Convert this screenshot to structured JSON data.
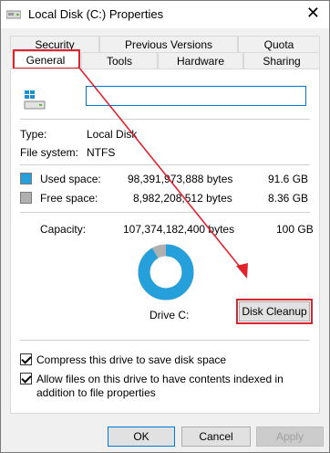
{
  "window": {
    "title": "Local Disk (C:) Properties",
    "close": "✕"
  },
  "tabs": {
    "row1": [
      {
        "label": "Security"
      },
      {
        "label": "Previous Versions"
      },
      {
        "label": "Quota"
      }
    ],
    "row2": [
      {
        "label": "General"
      },
      {
        "label": "Tools"
      },
      {
        "label": "Hardware"
      },
      {
        "label": "Sharing"
      }
    ]
  },
  "general": {
    "name_value": "",
    "type_label": "Type:",
    "type_value": "Local Disk",
    "fs_label": "File system:",
    "fs_value": "NTFS",
    "used_label": "Used space:",
    "used_bytes": "98,391,973,888 bytes",
    "used_gb": "91.6 GB",
    "free_label": "Free space:",
    "free_bytes": "8,982,208,512 bytes",
    "free_gb": "8.36 GB",
    "capacity_label": "Capacity:",
    "capacity_bytes": "107,374,182,400 bytes",
    "capacity_gb": "100 GB",
    "drive_label": "Drive C:",
    "cleanup_button": "Disk Cleanup",
    "compress_label": "Compress this drive to save disk space",
    "index_label": "Allow files on this drive to have contents indexed in addition to file properties",
    "compress_checked": true,
    "index_checked": true,
    "used_fraction": 0.916,
    "colors": {
      "used": "#26a0da",
      "free": "#b0b0b0"
    }
  },
  "buttons": {
    "ok": "OK",
    "cancel": "Cancel",
    "apply": "Apply"
  }
}
